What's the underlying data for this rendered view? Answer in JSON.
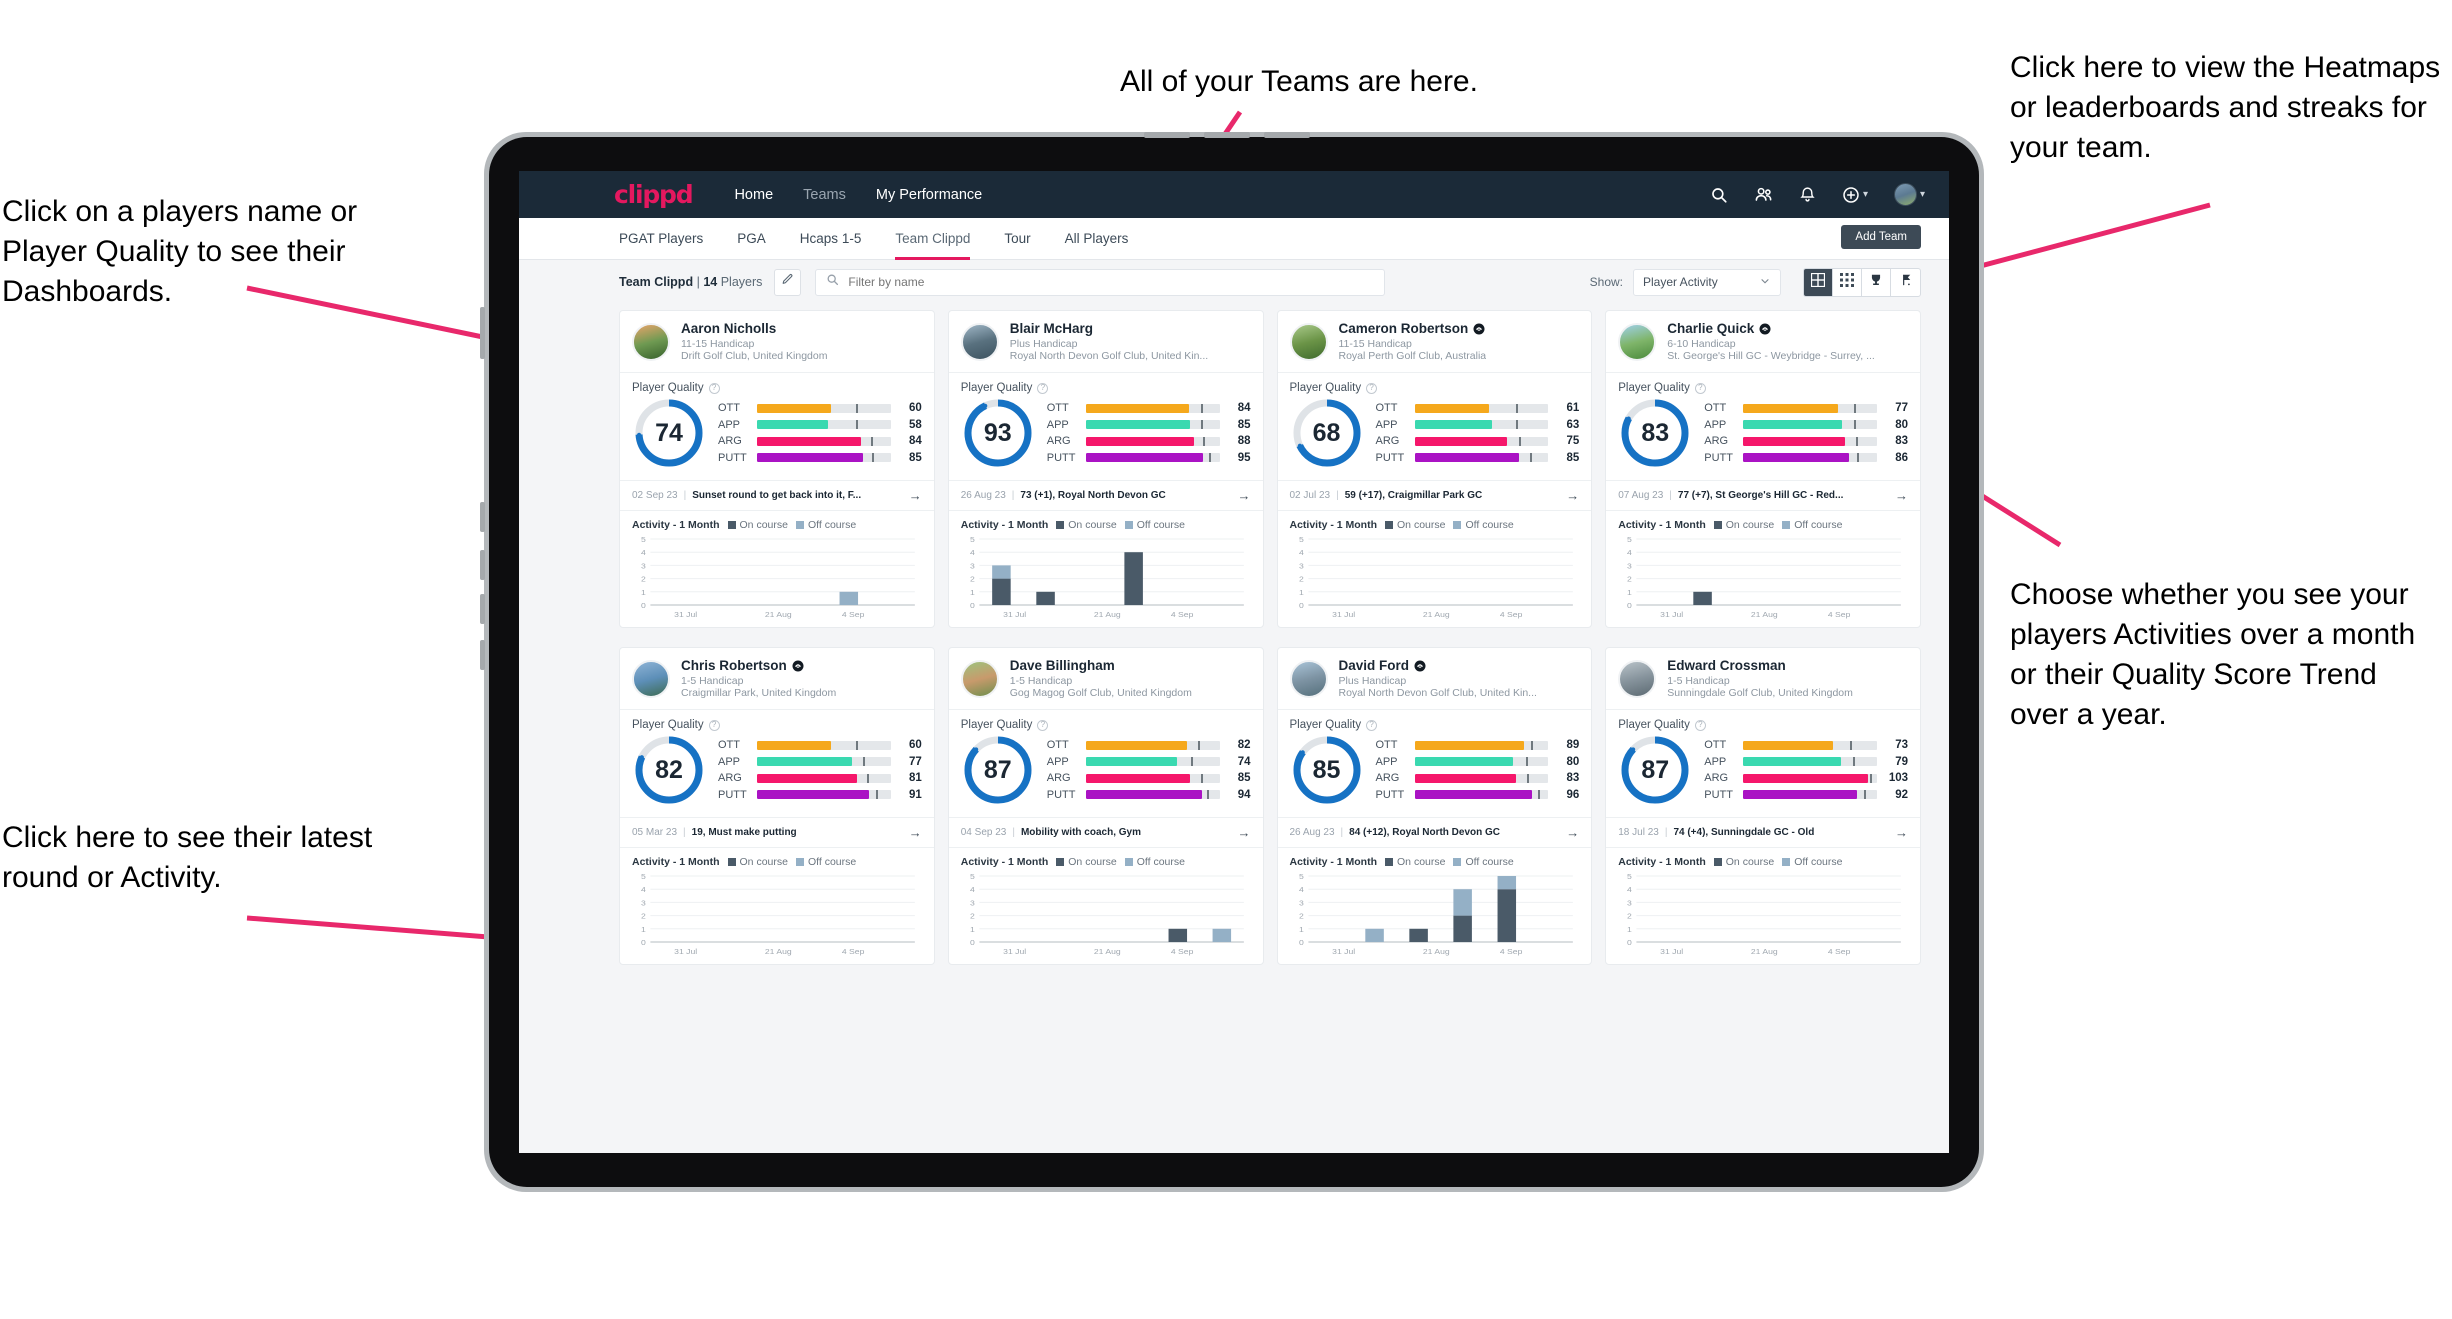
{
  "annotations": [
    {
      "id": "players-name",
      "text": "Click on a players name or Player Quality to see their Dashboards."
    },
    {
      "id": "teams",
      "text": "All of your Teams are here."
    },
    {
      "id": "heatmaps",
      "text": "Click here to view the Heatmaps or leaderboards and streaks for your team."
    },
    {
      "id": "activity-toggle",
      "text": "Choose whether you see your players Activities over a month or their Quality Score Trend over a year."
    },
    {
      "id": "latest-round",
      "text": "Click here to see their latest round or Activity."
    }
  ],
  "topnav": {
    "logo": "clippd",
    "links": [
      {
        "label": "Home",
        "active": true
      },
      {
        "label": "Teams",
        "active": false
      },
      {
        "label": "My Performance",
        "active": true
      }
    ],
    "icons": [
      "search-icon",
      "people-icon",
      "bell-icon",
      "plus-circle-icon",
      "avatar"
    ]
  },
  "tabs": [
    {
      "label": "PGAT Players",
      "active": false
    },
    {
      "label": "PGA",
      "active": false
    },
    {
      "label": "Hcaps 1-5",
      "active": false
    },
    {
      "label": "Team Clippd",
      "active": true
    },
    {
      "label": "Tour",
      "active": false
    },
    {
      "label": "All Players",
      "active": false
    }
  ],
  "add_team_label": "Add Team",
  "filterbar": {
    "team_name": "Team Clippd",
    "separator": "|",
    "player_count": "14",
    "players_word": "Players",
    "edit_icon": "pencil-icon",
    "search_placeholder": "Filter by name",
    "search_value": "",
    "show_label": "Show:",
    "show_value": "Player Activity",
    "show_options": [
      "Player Activity",
      "Quality Score Trend"
    ],
    "views": [
      {
        "name": "grid-view",
        "active": true
      },
      {
        "name": "dense-grid-view",
        "active": false
      },
      {
        "name": "trophy-leaderboard-view",
        "active": false
      },
      {
        "name": "flagstick-view",
        "active": false
      }
    ]
  },
  "card_labels": {
    "player_quality": "Player Quality",
    "activity": "Activity - 1 Month",
    "legend_on": "On course",
    "legend_off": "Off course",
    "skill_names": [
      "OTT",
      "APP",
      "ARG",
      "PUTT"
    ]
  },
  "colors": {
    "brand_pink": "#e4185f",
    "nav_dark": "#1b2a38",
    "ring_blue": "#1672c4",
    "ott": "#f5a81c",
    "app": "#3ad9b0",
    "arg": "#f5176b",
    "putt": "#aa13c4",
    "on_course": "#4a5a68",
    "off_course": "#94b0c6"
  },
  "players": [
    {
      "name": "Aaron Nicholls",
      "verified": false,
      "handicap": "11-15 Handicap",
      "club": "Drift Golf Club, United Kingdom",
      "quality": 74,
      "skills": [
        {
          "name": "OTT",
          "value": 60,
          "fill_pct": 55,
          "tick_pct": 74
        },
        {
          "name": "APP",
          "value": 58,
          "fill_pct": 53,
          "tick_pct": 74
        },
        {
          "name": "ARG",
          "value": 84,
          "fill_pct": 78,
          "tick_pct": 85
        },
        {
          "name": "PUTT",
          "value": 85,
          "fill_pct": 79,
          "tick_pct": 86
        }
      ],
      "round": {
        "date": "02 Sep 23",
        "text": "Sunset round to get back into it, F..."
      },
      "chart": {
        "on": [
          0,
          0,
          0,
          0,
          0,
          0
        ],
        "off": [
          0,
          0,
          0,
          0,
          1,
          0
        ]
      }
    },
    {
      "name": "Blair McHarg",
      "verified": false,
      "handicap": "Plus Handicap",
      "club": "Royal North Devon Golf Club, United Kin...",
      "quality": 93,
      "skills": [
        {
          "name": "OTT",
          "value": 84,
          "fill_pct": 77,
          "tick_pct": 86
        },
        {
          "name": "APP",
          "value": 85,
          "fill_pct": 78,
          "tick_pct": 86
        },
        {
          "name": "ARG",
          "value": 88,
          "fill_pct": 81,
          "tick_pct": 88
        },
        {
          "name": "PUTT",
          "value": 95,
          "fill_pct": 88,
          "tick_pct": 92
        }
      ],
      "round": {
        "date": "26 Aug 23",
        "text": "73 (+1), Royal North Devon GC"
      },
      "chart": {
        "on": [
          2,
          1,
          0,
          4,
          0,
          0
        ],
        "off": [
          1,
          0,
          0,
          0,
          0,
          0
        ]
      }
    },
    {
      "name": "Cameron Robertson",
      "verified": true,
      "handicap": "11-15 Handicap",
      "club": "Royal Perth Golf Club, Australia",
      "quality": 68,
      "skills": [
        {
          "name": "OTT",
          "value": 61,
          "fill_pct": 56,
          "tick_pct": 76
        },
        {
          "name": "APP",
          "value": 63,
          "fill_pct": 58,
          "tick_pct": 76
        },
        {
          "name": "ARG",
          "value": 75,
          "fill_pct": 69,
          "tick_pct": 78
        },
        {
          "name": "PUTT",
          "value": 85,
          "fill_pct": 78,
          "tick_pct": 86
        }
      ],
      "round": {
        "date": "02 Jul 23",
        "text": "59 (+17), Craigmillar Park GC"
      },
      "chart": {
        "on": [
          0,
          0,
          0,
          0,
          0,
          0
        ],
        "off": [
          0,
          0,
          0,
          0,
          0,
          0
        ]
      }
    },
    {
      "name": "Charlie Quick",
      "verified": true,
      "handicap": "6-10 Handicap",
      "club": "St. George's Hill GC - Weybridge - Surrey, ...",
      "quality": 83,
      "skills": [
        {
          "name": "OTT",
          "value": 77,
          "fill_pct": 71,
          "tick_pct": 83
        },
        {
          "name": "APP",
          "value": 80,
          "fill_pct": 74,
          "tick_pct": 83
        },
        {
          "name": "ARG",
          "value": 83,
          "fill_pct": 76,
          "tick_pct": 84
        },
        {
          "name": "PUTT",
          "value": 86,
          "fill_pct": 79,
          "tick_pct": 85
        }
      ],
      "round": {
        "date": "07 Aug 23",
        "text": "77 (+7), St George's Hill GC - Red..."
      },
      "chart": {
        "on": [
          0,
          1,
          0,
          0,
          0,
          0
        ],
        "off": [
          0,
          0,
          0,
          0,
          0,
          0
        ]
      }
    },
    {
      "name": "Chris Robertson",
      "verified": true,
      "handicap": "1-5 Handicap",
      "club": "Craigmillar Park, United Kingdom",
      "quality": 82,
      "skills": [
        {
          "name": "OTT",
          "value": 60,
          "fill_pct": 55,
          "tick_pct": 74
        },
        {
          "name": "APP",
          "value": 77,
          "fill_pct": 71,
          "tick_pct": 79
        },
        {
          "name": "ARG",
          "value": 81,
          "fill_pct": 75,
          "tick_pct": 82
        },
        {
          "name": "PUTT",
          "value": 91,
          "fill_pct": 84,
          "tick_pct": 89
        }
      ],
      "round": {
        "date": "05 Mar 23",
        "text": "19, Must make putting"
      },
      "chart": {
        "on": [
          0,
          0,
          0,
          0,
          0,
          0
        ],
        "off": [
          0,
          0,
          0,
          0,
          0,
          0
        ]
      }
    },
    {
      "name": "Dave Billingham",
      "verified": false,
      "handicap": "1-5 Handicap",
      "club": "Gog Magog Golf Club, United Kingdom",
      "quality": 87,
      "skills": [
        {
          "name": "OTT",
          "value": 82,
          "fill_pct": 76,
          "tick_pct": 84
        },
        {
          "name": "APP",
          "value": 74,
          "fill_pct": 68,
          "tick_pct": 79
        },
        {
          "name": "ARG",
          "value": 85,
          "fill_pct": 78,
          "tick_pct": 86
        },
        {
          "name": "PUTT",
          "value": 94,
          "fill_pct": 87,
          "tick_pct": 91
        }
      ],
      "round": {
        "date": "04 Sep 23",
        "text": "Mobility with coach, Gym"
      },
      "chart": {
        "on": [
          0,
          0,
          0,
          0,
          1,
          0
        ],
        "off": [
          0,
          0,
          0,
          0,
          0,
          1
        ]
      }
    },
    {
      "name": "David Ford",
      "verified": true,
      "handicap": "Plus Handicap",
      "club": "Royal North Devon Golf Club, United Kin...",
      "quality": 85,
      "skills": [
        {
          "name": "OTT",
          "value": 89,
          "fill_pct": 82,
          "tick_pct": 87
        },
        {
          "name": "APP",
          "value": 80,
          "fill_pct": 74,
          "tick_pct": 83
        },
        {
          "name": "ARG",
          "value": 83,
          "fill_pct": 76,
          "tick_pct": 84
        },
        {
          "name": "PUTT",
          "value": 96,
          "fill_pct": 88,
          "tick_pct": 92
        }
      ],
      "round": {
        "date": "26 Aug 23",
        "text": "84 (+12), Royal North Devon GC"
      },
      "chart": {
        "on": [
          0,
          0,
          1,
          2,
          4,
          0
        ],
        "off": [
          0,
          1,
          0,
          2,
          1,
          0
        ]
      }
    },
    {
      "name": "Edward Crossman",
      "verified": false,
      "handicap": "1-5 Handicap",
      "club": "Sunningdale Golf Club, United Kingdom",
      "quality": 87,
      "skills": [
        {
          "name": "OTT",
          "value": 73,
          "fill_pct": 67,
          "tick_pct": 80
        },
        {
          "name": "APP",
          "value": 79,
          "fill_pct": 73,
          "tick_pct": 82
        },
        {
          "name": "ARG",
          "value": 103,
          "fill_pct": 93,
          "tick_pct": 95
        },
        {
          "name": "PUTT",
          "value": 92,
          "fill_pct": 85,
          "tick_pct": 90
        }
      ],
      "round": {
        "date": "18 Jul 23",
        "text": "74 (+4), Sunningdale GC - Old"
      },
      "chart": {
        "on": [
          0,
          0,
          0,
          0,
          0,
          0
        ],
        "off": [
          0,
          0,
          0,
          0,
          0,
          0
        ]
      }
    }
  ],
  "chart_data": {
    "type": "bar",
    "title": "Activity - 1 Month",
    "subtype": "stacked",
    "ylabel": "",
    "xlabel": "",
    "ylim": [
      0,
      5
    ],
    "yticks": [
      0,
      1,
      2,
      3,
      4,
      5
    ],
    "xtick_labels": [
      "31 Jul",
      "21 Aug",
      "4 Sep"
    ],
    "grid": true,
    "legend_position": "top",
    "series": [
      {
        "name": "On course",
        "color": "#4a5a68"
      },
      {
        "name": "Off course",
        "color": "#94b0c6"
      }
    ],
    "panels": [
      {
        "player": "Aaron Nicholls",
        "on": [
          0,
          0,
          0,
          0,
          0,
          0
        ],
        "off": [
          0,
          0,
          0,
          0,
          1,
          0
        ]
      },
      {
        "player": "Blair McHarg",
        "on": [
          2,
          1,
          0,
          4,
          0,
          0
        ],
        "off": [
          1,
          0,
          0,
          0,
          0,
          0
        ]
      },
      {
        "player": "Cameron Robertson",
        "on": [
          0,
          0,
          0,
          0,
          0,
          0
        ],
        "off": [
          0,
          0,
          0,
          0,
          0,
          0
        ]
      },
      {
        "player": "Charlie Quick",
        "on": [
          0,
          1,
          0,
          0,
          0,
          0
        ],
        "off": [
          0,
          0,
          0,
          0,
          0,
          0
        ]
      },
      {
        "player": "Chris Robertson",
        "on": [
          0,
          0,
          0,
          0,
          0,
          0
        ],
        "off": [
          0,
          0,
          0,
          0,
          0,
          0
        ]
      },
      {
        "player": "Dave Billingham",
        "on": [
          0,
          0,
          0,
          0,
          1,
          0
        ],
        "off": [
          0,
          0,
          0,
          0,
          0,
          1
        ]
      },
      {
        "player": "David Ford",
        "on": [
          0,
          0,
          1,
          2,
          4,
          0
        ],
        "off": [
          0,
          1,
          0,
          2,
          1,
          0
        ]
      },
      {
        "player": "Edward Crossman",
        "on": [
          0,
          0,
          0,
          0,
          0,
          0
        ],
        "off": [
          0,
          0,
          0,
          0,
          0,
          0
        ]
      }
    ]
  }
}
